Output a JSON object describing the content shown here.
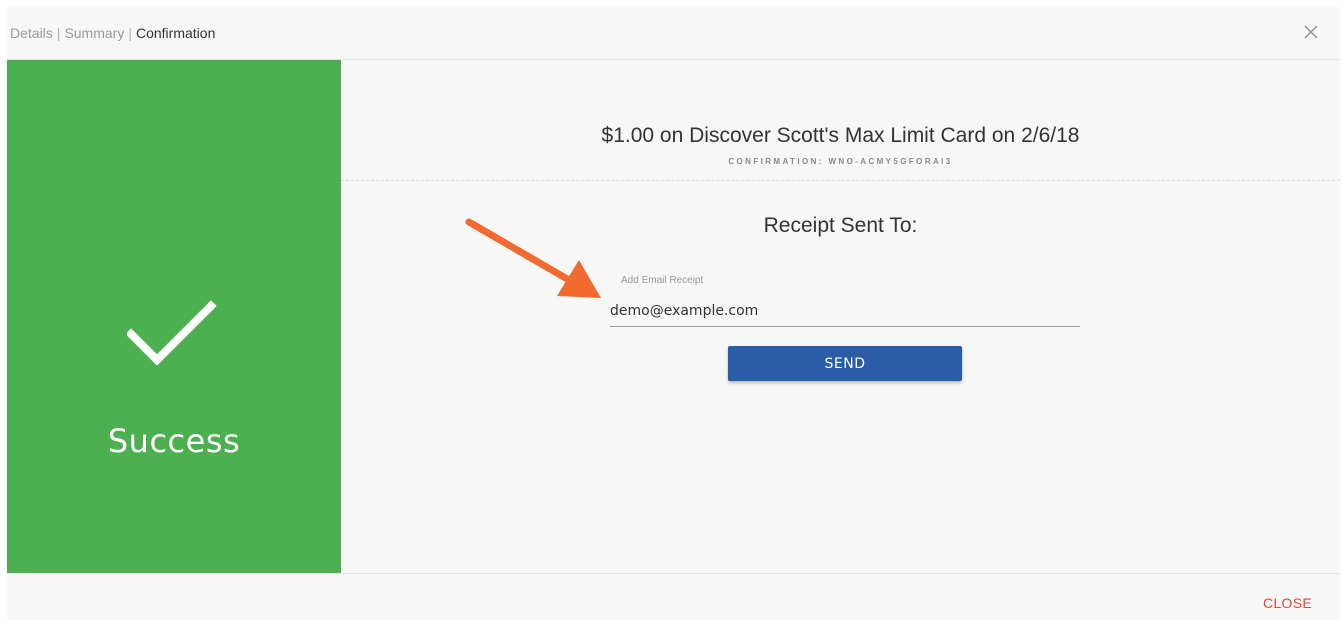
{
  "breadcrumb": {
    "steps": [
      "Details",
      "Summary",
      "Confirmation"
    ],
    "separator": "|",
    "active_index": 2
  },
  "header": {
    "close_icon": "close-icon"
  },
  "status_panel": {
    "icon": "checkmark-icon",
    "label": "Success",
    "color": "#4caf50"
  },
  "payment": {
    "headline": "$1.00 on Discover Scott's Max Limit Card on 2/6/18",
    "confirmation": "CONFIRMATION: WNO-ACMY5GFORAI3"
  },
  "receipt": {
    "title": "Receipt Sent To:",
    "field_label": "Add Email Receipt",
    "email_value": "demo@example.com",
    "send_label": "SEND",
    "send_color": "#2a5ca8"
  },
  "annotation": {
    "icon": "arrow-icon",
    "color": "#f26a2e"
  },
  "footer": {
    "close_label": "CLOSE",
    "close_color": "#e04a2f"
  }
}
